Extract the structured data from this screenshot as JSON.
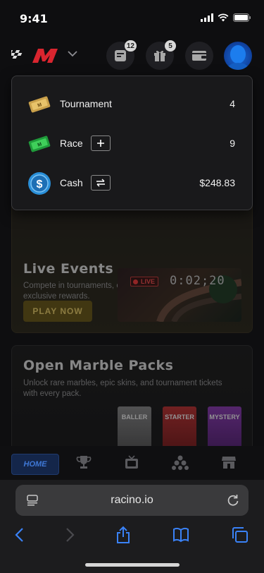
{
  "status_bar": {
    "time": "9:41"
  },
  "header": {
    "notifications_badge": "12",
    "gifts_badge": "5"
  },
  "wallet_menu": {
    "rows": [
      {
        "label": "Tournament",
        "value": "4",
        "icon": "tournament-ticket-icon"
      },
      {
        "label": "Race",
        "value": "9",
        "icon": "race-ticket-icon",
        "action": "plus-icon"
      },
      {
        "label": "Cash",
        "value": "$248.83",
        "icon": "dollar-coin-icon",
        "action": "swap-icon"
      }
    ]
  },
  "live_events": {
    "title": "Live Events",
    "description": "Compete in tournaments, climb the rankings, and win exclusive rewards.",
    "cta": "PLAY NOW",
    "live_label": "LIVE",
    "timer": "0:02;20"
  },
  "packs": {
    "title": "Open Marble Packs",
    "description": "Unlock rare marbles, epic skins, and tournament tickets with every pack.",
    "items": [
      "BALLER",
      "STARTER",
      "MYSTERY"
    ]
  },
  "bottom_nav": {
    "home_label": "HOME"
  },
  "browser": {
    "url": "racino.io"
  },
  "colors": {
    "accent_gold": "#f2d56a",
    "live_red": "#ff4c4c",
    "home_blue": "#3f78d6",
    "ios_blue": "#3a82f7"
  }
}
